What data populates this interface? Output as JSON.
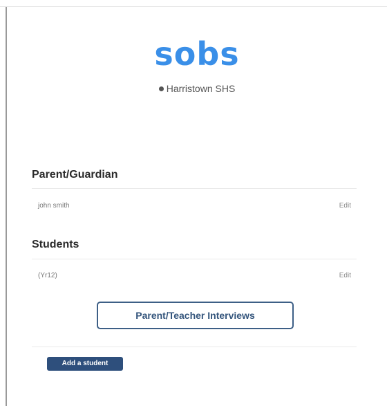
{
  "header": {
    "logo_text": "sobs",
    "school_name": "Harristown SHS"
  },
  "parent_section": {
    "heading": "Parent/Guardian",
    "name": "john smith",
    "edit_label": "Edit"
  },
  "students_section": {
    "heading": "Students",
    "student_label": "(Yr12)",
    "edit_label": "Edit",
    "interviews_button_label": "Parent/Teacher Interviews",
    "add_student_label": "Add a student"
  },
  "colors": {
    "brand": "#3a8fe8",
    "button_border": "#3d5f86",
    "button_fill": "#2e4f7c"
  }
}
